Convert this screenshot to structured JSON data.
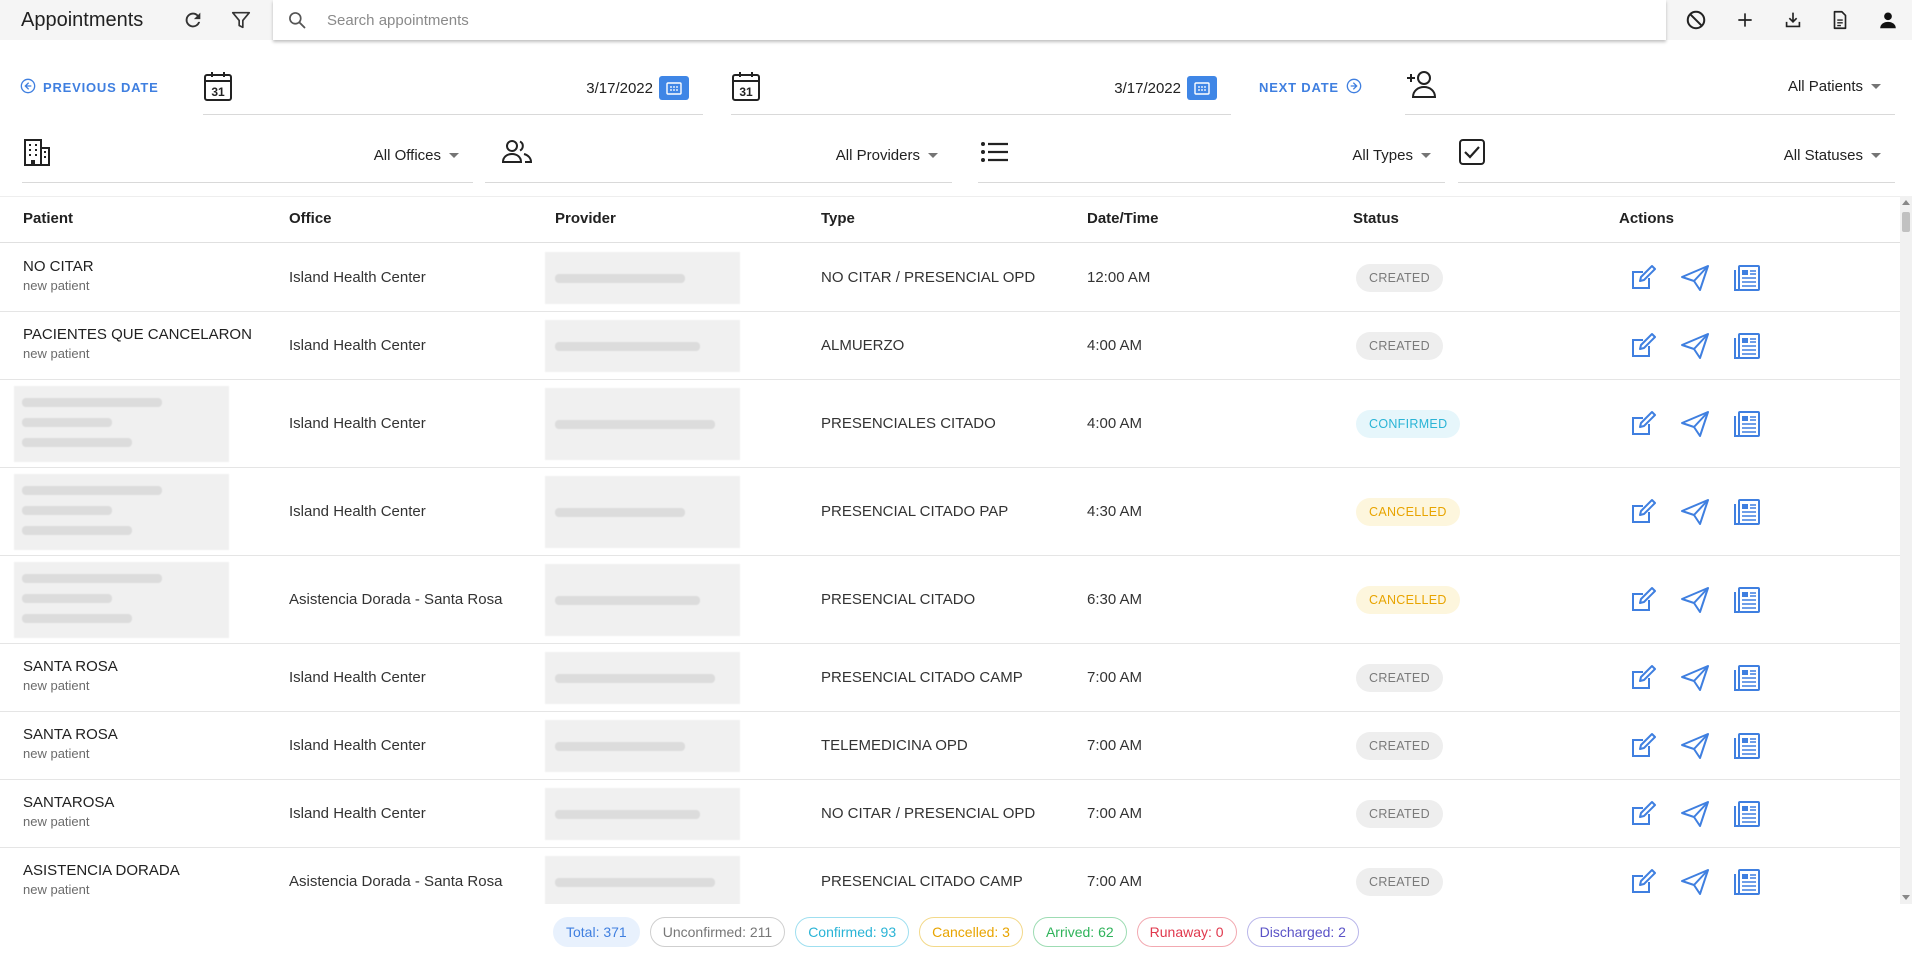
{
  "header": {
    "title": "Appointments",
    "search_placeholder": "Search appointments",
    "left_icons": [
      "refresh-icon",
      "filter-icon"
    ],
    "right_icons": [
      "block-icon",
      "add-icon",
      "download-icon",
      "document-icon",
      "account-icon"
    ]
  },
  "date_bar": {
    "previous_label": "PREVIOUS DATE",
    "start_date": "3/17/2022",
    "end_date": "3/17/2022",
    "next_label": "NEXT DATE",
    "patients_filter": "All Patients"
  },
  "filters": {
    "offices": "All Offices",
    "providers": "All Providers",
    "types": "All Types",
    "statuses": "All Statuses"
  },
  "table": {
    "columns": [
      "Patient",
      "Office",
      "Provider",
      "Type",
      "Date/Time",
      "Status",
      "Actions"
    ],
    "rows": [
      {
        "patient": "NO CITAR",
        "patient_sub": "new patient",
        "office": "Island Health Center",
        "type": "NO CITAR / PRESENCIAL OPD",
        "time": "12:00 AM",
        "status": "CREATED"
      },
      {
        "patient": "PACIENTES QUE CANCELARON",
        "patient_sub": "new patient",
        "office": "Island Health Center",
        "type": "ALMUERZO",
        "time": "4:00 AM",
        "status": "CREATED"
      },
      {
        "patient": "",
        "patient_sub": "",
        "office": "Island Health Center",
        "type": "PRESENCIALES CITADO",
        "time": "4:00 AM",
        "status": "CONFIRMED"
      },
      {
        "patient": "",
        "patient_sub": "",
        "office": "Island Health Center",
        "type": "PRESENCIAL CITADO PAP",
        "time": "4:30 AM",
        "status": "CANCELLED"
      },
      {
        "patient": "",
        "patient_sub": "",
        "office": "Asistencia Dorada - Santa Rosa",
        "type": "PRESENCIAL CITADO",
        "time": "6:30 AM",
        "status": "CANCELLED"
      },
      {
        "patient": "SANTA ROSA",
        "patient_sub": "new patient",
        "office": "Island Health Center",
        "type": "PRESENCIAL CITADO CAMP",
        "time": "7:00 AM",
        "status": "CREATED"
      },
      {
        "patient": "SANTA ROSA",
        "patient_sub": "new patient",
        "office": "Island Health Center",
        "type": "TELEMEDICINA OPD",
        "time": "7:00 AM",
        "status": "CREATED"
      },
      {
        "patient": "SANTAROSA",
        "patient_sub": "new patient",
        "office": "Island Health Center",
        "type": "NO CITAR / PRESENCIAL OPD",
        "time": "7:00 AM",
        "status": "CREATED"
      },
      {
        "patient": "ASISTENCIA DORADA",
        "patient_sub": "new patient",
        "office": "Asistencia Dorada - Santa Rosa",
        "type": "PRESENCIAL CITADO CAMP",
        "time": "7:00 AM",
        "status": "CREATED"
      }
    ],
    "row_actions": [
      "edit-icon",
      "send-icon",
      "report-icon"
    ]
  },
  "summary": {
    "total": "Total: 371",
    "unconfirmed": "Unconfirmed: 211",
    "confirmed": "Confirmed: 93",
    "cancelled": "Cancelled: 3",
    "arrived": "Arrived: 62",
    "runaway": "Runaway: 0",
    "discharged": "Discharged: 2"
  },
  "colors": {
    "accent": "#3f7fe0",
    "created": "#7a7a7a",
    "confirmed": "#2ab4d6",
    "cancelled": "#e8a400",
    "arrived": "#2fb35a",
    "runaway": "#e0384d",
    "discharged": "#5a52c7"
  }
}
